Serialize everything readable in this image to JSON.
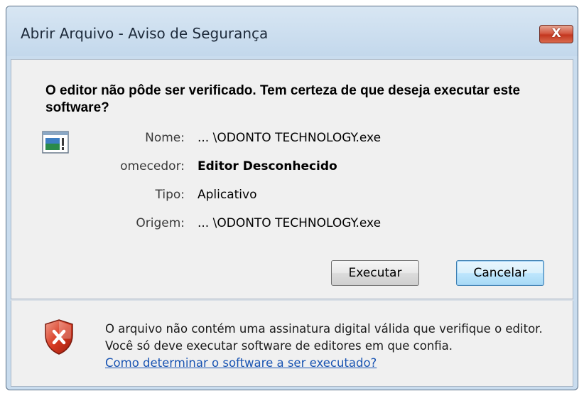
{
  "window": {
    "title": "Abrir Arquivo - Aviso de Segurança",
    "close_glyph": "X"
  },
  "dialog": {
    "headline": "O editor não pôde ser verificado. Tem certeza de que deseja executar este software?",
    "app_icon": "application-icon",
    "fields": [
      {
        "label": "Nome:",
        "value": "... \\ODONTO TECHNOLOGY.exe",
        "bold": false
      },
      {
        "label": "omecedor:",
        "value": "Editor Desconhecido",
        "bold": true
      },
      {
        "label": "Tipo:",
        "value": "Aplicativo",
        "bold": false
      },
      {
        "label": "Origem:",
        "value": "... \\ODONTO TECHNOLOGY.exe",
        "bold": false
      }
    ],
    "buttons": {
      "execute": "Executar",
      "cancel": "Cancelar"
    }
  },
  "footer": {
    "warning_icon": "shield-error-icon",
    "message": "O arquivo não contém uma assinatura digital válida que verifique o editor. Você só deve executar software de editores em que confia.",
    "link": "Como determinar o software a ser executado?"
  },
  "colors": {
    "frame": "#c9dcee",
    "panel": "#f0f0f0",
    "close_red": "#c4371f",
    "link_blue": "#1a55b3",
    "cancel_focus": "#3c7fb1"
  }
}
